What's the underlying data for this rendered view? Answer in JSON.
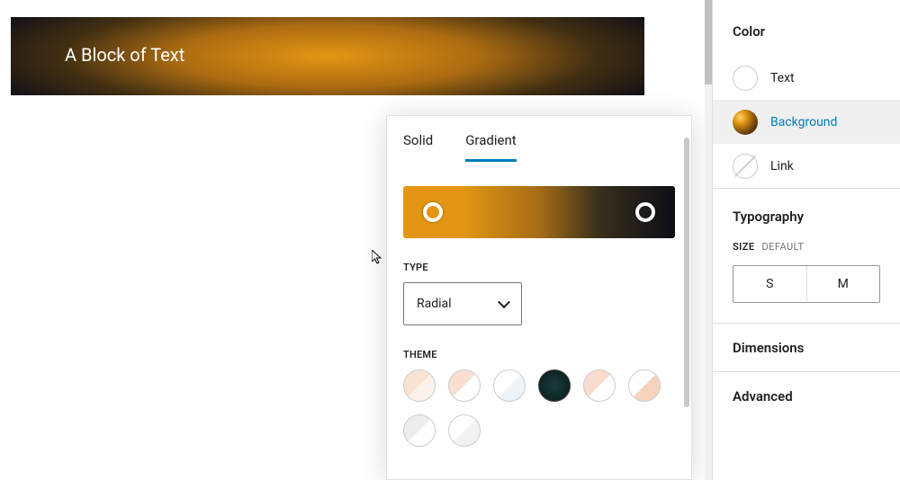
{
  "block": {
    "text": "A Block of Text"
  },
  "popover": {
    "tabs": {
      "solid": "Solid",
      "gradient": "Gradient",
      "active": "gradient"
    },
    "type_label": "TYPE",
    "type_value": "Radial",
    "theme_label": "THEME"
  },
  "sidebar": {
    "color": {
      "title": "Color",
      "text": "Text",
      "background": "Background",
      "link": "Link"
    },
    "typography": {
      "title": "Typography",
      "size_label": "SIZE",
      "size_default": "DEFAULT",
      "sizes": {
        "s": "S",
        "m": "M"
      }
    },
    "dimensions": "Dimensions",
    "advanced": "Advanced"
  }
}
